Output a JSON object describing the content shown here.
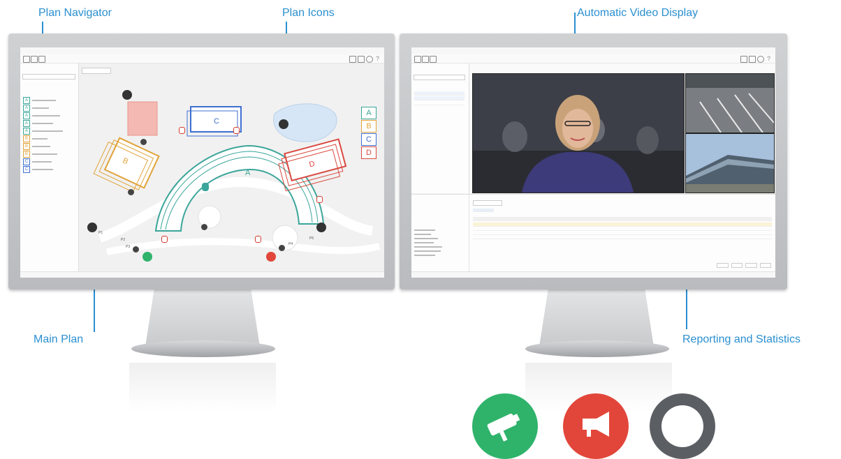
{
  "callouts": {
    "plan_navigator": "Plan Navigator",
    "plan_icons": "Plan Icons",
    "automatic_video_display": "Automatic Video Display",
    "main_plan": "Main Plan",
    "reporting_and_statistics": "Reporting and Statistics"
  },
  "left_screen": {
    "buildings": [
      "A",
      "B",
      "C",
      "D"
    ],
    "building_colors": {
      "A": "#3aa59a",
      "B": "#e2a33a",
      "C": "#3f6fcf",
      "D": "#d9493f"
    },
    "nav_badges": [
      "A",
      "A",
      "A",
      "A",
      "A",
      "B",
      "B",
      "B",
      "C",
      "C"
    ],
    "parking_labels": [
      "P1",
      "P2",
      "P3",
      "P4",
      "P5"
    ]
  },
  "right_screen": {
    "video_tiles": 3
  },
  "bottom_icons": [
    {
      "icon": "camera-icon",
      "color": "#2fb36b"
    },
    {
      "icon": "megaphone-icon",
      "color": "#e2463a"
    },
    {
      "icon": "speech-bubble-icon",
      "color": "#5b5f63"
    }
  ],
  "colors": {
    "accent": "#2a8fd0"
  }
}
